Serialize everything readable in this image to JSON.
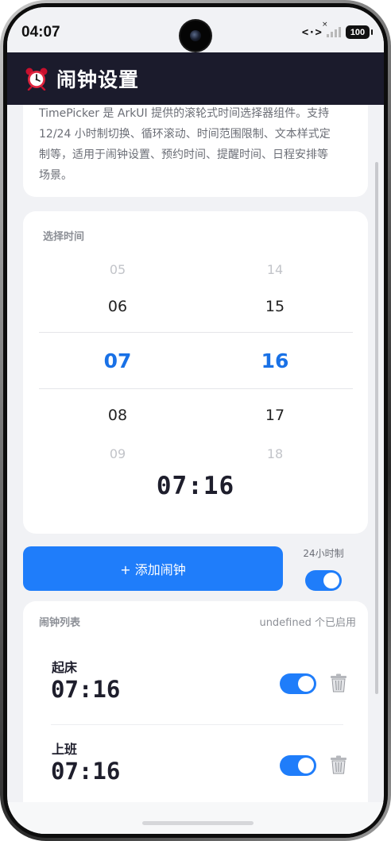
{
  "status_bar": {
    "time": "04:07",
    "network_icon": "<·>",
    "signal_x": "×",
    "battery": "100"
  },
  "header": {
    "icon": "alarm-clock-icon",
    "title": "闹钟设置"
  },
  "intro": {
    "line1": "TimePicker 是 ArkUI 提供的滚轮式时间选择器组件。支持",
    "line2": "12/24 小时制切换、循环滚动、时间范围限制、文本样式定",
    "line3": "制等，适用于闹钟设置、预约时间、提醒时间、日程安排等",
    "line4": "场景。"
  },
  "picker": {
    "label": "选择时间",
    "hours": [
      "05",
      "06",
      "07",
      "08",
      "09"
    ],
    "minutes": [
      "14",
      "15",
      "16",
      "17",
      "18"
    ],
    "display": "07:16"
  },
  "actions": {
    "add_alarm": "+ 添加闹钟",
    "mode_label": "24小时制",
    "mode_on": true
  },
  "alarm_list": {
    "header": "闹钟列表",
    "count_text": "undefined 个已启用",
    "items": [
      {
        "name": "起床",
        "time": "07:16",
        "enabled": true
      },
      {
        "name": "上班",
        "time": "07:16",
        "enabled": true
      }
    ]
  },
  "colors": {
    "accent": "#1f7dfa",
    "selected": "#1971e6",
    "header_bg": "#1b1b2c",
    "page_bg": "#f1f2f5"
  }
}
